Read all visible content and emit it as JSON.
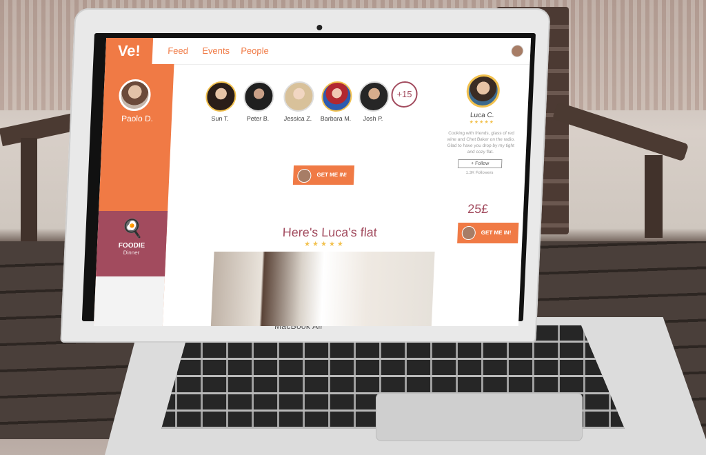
{
  "app": {
    "logo": "Ve!"
  },
  "nav": {
    "items": [
      "Feed",
      "Events",
      "People"
    ]
  },
  "sidebar": {
    "user_name": "Paolo D.",
    "category": {
      "title": "FOODIE",
      "subtitle": "Dinner",
      "icon": "chef-hat-icon"
    }
  },
  "people": {
    "list": [
      {
        "name": "Sun T."
      },
      {
        "name": "Peter B."
      },
      {
        "name": "Jessica Z."
      },
      {
        "name": "Barbara M."
      },
      {
        "name": "Josh P."
      }
    ],
    "more": "+15"
  },
  "cta": {
    "label": "GET ME IN!"
  },
  "host": {
    "name": "Luca C.",
    "stars": "★★★★★",
    "bio": "Cooking with friends, glass of red wine and Chet Baker on the radio. Glad to have you drop by my tight and cozy flat.",
    "follow_label": "+ Follow",
    "followers": "1.3K Followers",
    "price": "25£"
  },
  "flat": {
    "title": "Here's Luca's flat",
    "stars": "★★★★★"
  },
  "device": {
    "label": "MacBook Air"
  },
  "colors": {
    "accent": "#f07a45",
    "secondary": "#a24b5e",
    "star": "#f2c14e"
  }
}
